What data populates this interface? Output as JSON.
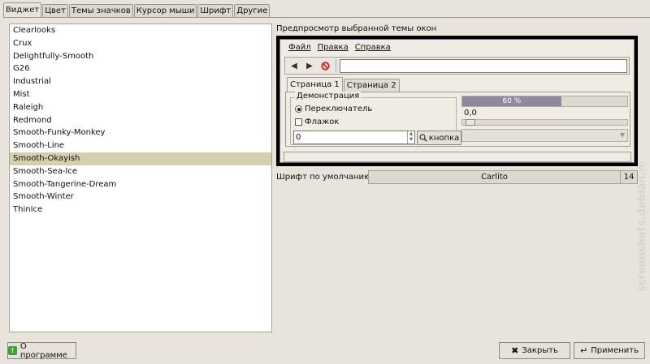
{
  "tabs": [
    "Виджет",
    "Цвет",
    "Темы значков",
    "Курсор мыши",
    "Шрифт",
    "Другие"
  ],
  "themes": [
    "Clearlooks",
    "Crux",
    "Delightfully-Smooth",
    "G26",
    "Industrial",
    "Mist",
    "Raleigh",
    "Redmond",
    "Smooth-Funky-Monkey",
    "Smooth-Line",
    "Smooth-Okayish",
    "Smooth-Sea-Ice",
    "Smooth-Tangerine-Dream",
    "Smooth-Winter",
    "ThinIce"
  ],
  "selected_theme": "Smooth-Okayish",
  "preview": {
    "title": "Предпросмотр выбранной темы окон",
    "menu": [
      "Файл",
      "Правка",
      "Справка"
    ],
    "tabs": [
      "Страница 1",
      "Страница 2"
    ],
    "group_label": "Демонстрация",
    "radio_label": "Переключатель",
    "check_label": "Флажок",
    "spin_value": "0",
    "button_label": "кнопка",
    "progress_text": "60 %",
    "progress_value": 0.6,
    "scale_value": "0,0"
  },
  "font": {
    "label": "Шрифт по умолчанию:",
    "name": "Carlito",
    "size": "14"
  },
  "buttons": {
    "about": "О программе",
    "close": "Закрыть",
    "apply": "Применить"
  },
  "watermark": "screenshots.debian.net",
  "colors": {
    "selection": "#d6cfae",
    "progress": "#8d89a3"
  }
}
